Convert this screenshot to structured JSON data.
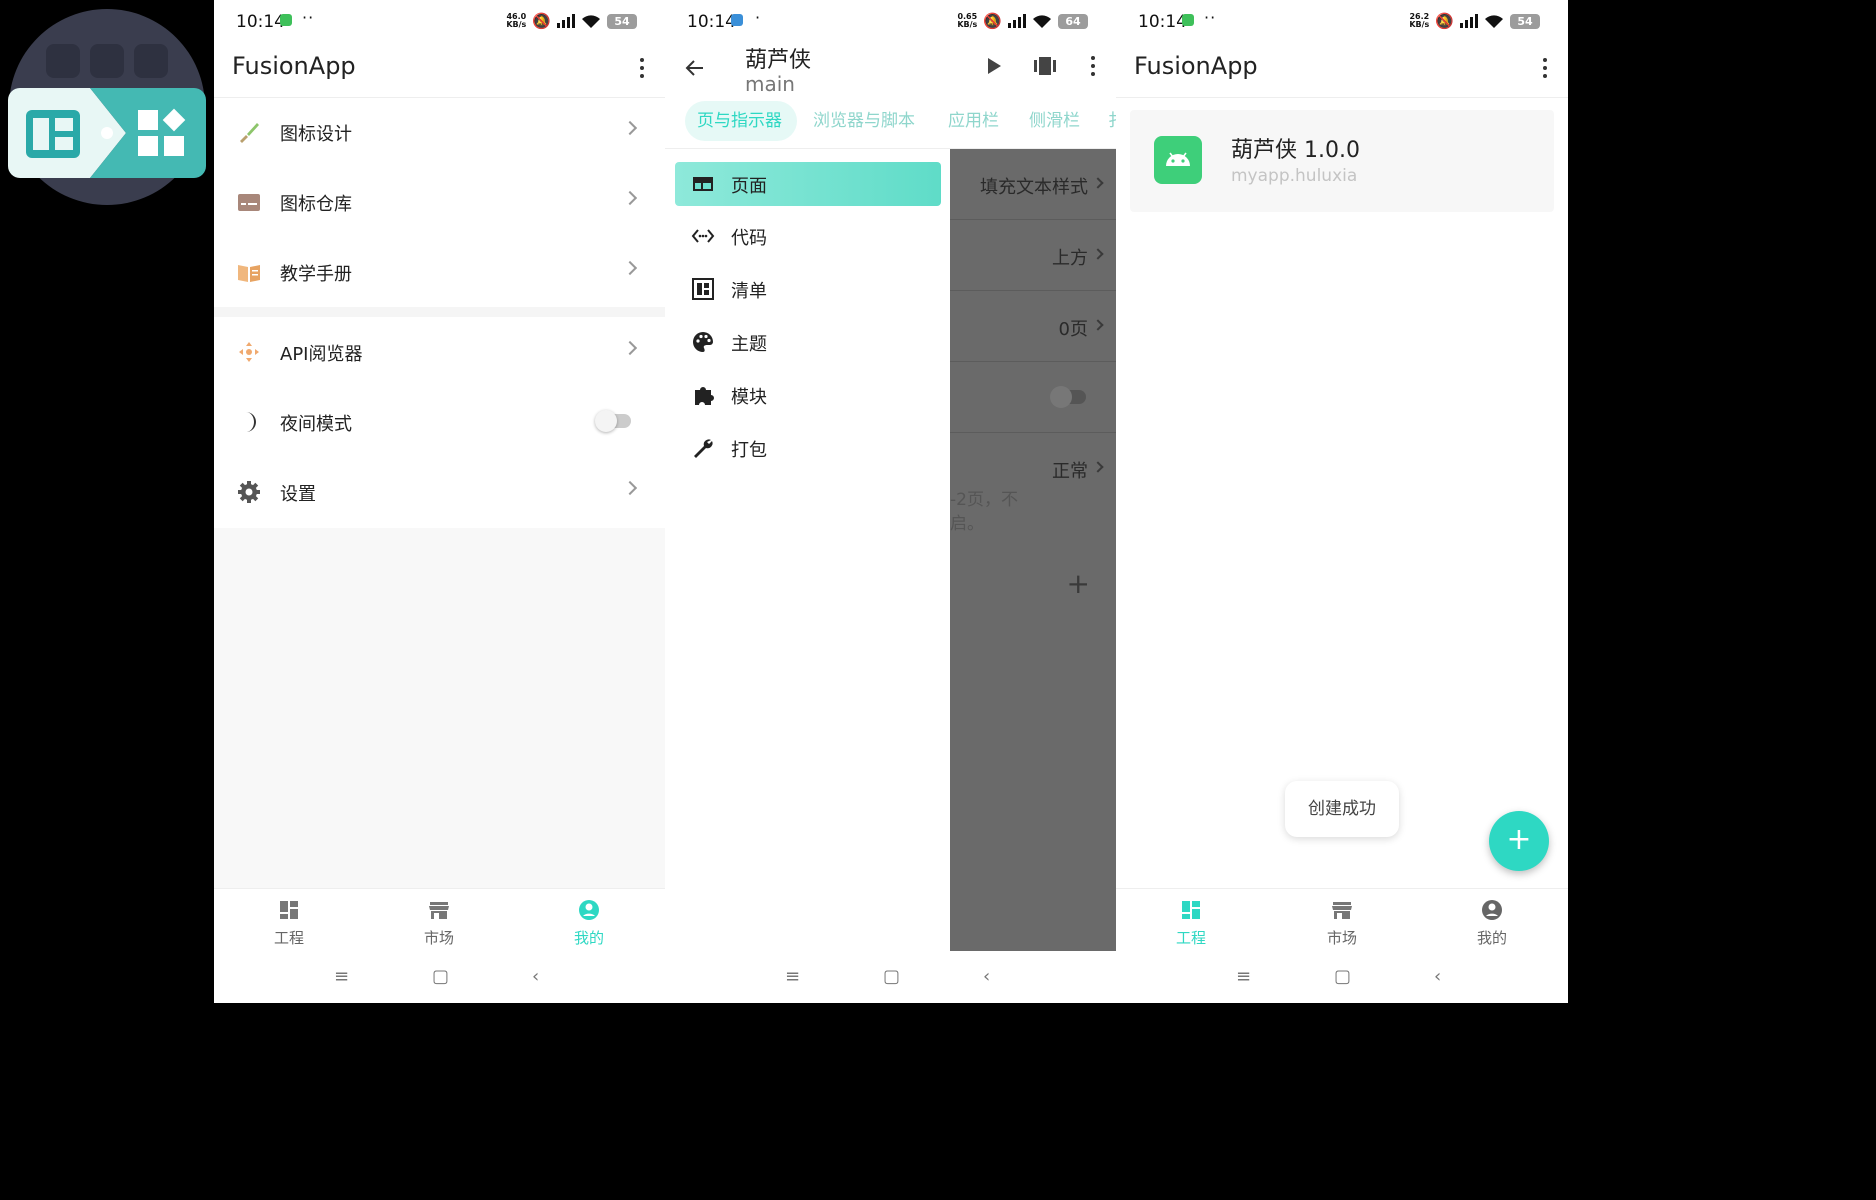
{
  "colors": {
    "accent": "#2ed8c3",
    "accent_light": "#b9f1e8",
    "scrim": "#6a6a6a"
  },
  "phone1": {
    "status": {
      "time": "10:14",
      "speed_top": "46.0",
      "speed_bottom": "KB/s",
      "battery": "54"
    },
    "title": "FusionApp",
    "menu": [
      {
        "label": "图标设计",
        "icon": "brush-icon"
      },
      {
        "label": "图标仓库",
        "icon": "inbox-icon"
      },
      {
        "label": "教学手册",
        "icon": "book-icon"
      },
      {
        "label": "API阅览器",
        "icon": "api-icon"
      },
      {
        "label": "夜间模式",
        "icon": "moon-icon"
      },
      {
        "label": "设置",
        "icon": "gear-icon"
      }
    ],
    "nav": [
      "工程",
      "市场",
      "我的"
    ]
  },
  "phone2": {
    "status": {
      "time": "10:14",
      "speed_top": "0.65",
      "speed_bottom": "KB/s",
      "battery": "64"
    },
    "title": "葫芦侠",
    "subtitle": "main",
    "tabs": [
      "页与指示器",
      "浏览器与脚本",
      "应用栏",
      "侧滑栏",
      "扌"
    ],
    "drawer": [
      {
        "label": "页面",
        "icon": "page-icon"
      },
      {
        "label": "代码",
        "icon": "code-icon"
      },
      {
        "label": "清单",
        "icon": "list-icon"
      },
      {
        "label": "主题",
        "icon": "palette-icon"
      },
      {
        "label": "模块",
        "icon": "puzzle-icon"
      },
      {
        "label": "打包",
        "icon": "wrench-icon"
      }
    ],
    "scrim_rows": [
      "填充文本样式",
      "上方",
      "0页",
      "",
      "正常"
    ],
    "scrim_hint_1": "-2页，不",
    "scrim_hint_2": "启。"
  },
  "phone3": {
    "status": {
      "time": "10:14",
      "speed_top": "26.2",
      "speed_bottom": "KB/s",
      "battery": "54"
    },
    "title": "FusionApp",
    "project": {
      "name": "葫芦侠 1.0.0",
      "package": "myapp.huluxia"
    },
    "toast": "创建成功",
    "fab": "+",
    "nav": [
      "工程",
      "市场",
      "我的"
    ]
  },
  "sysnav": {
    "menu": "≡",
    "home": "▢",
    "back": "‹"
  }
}
